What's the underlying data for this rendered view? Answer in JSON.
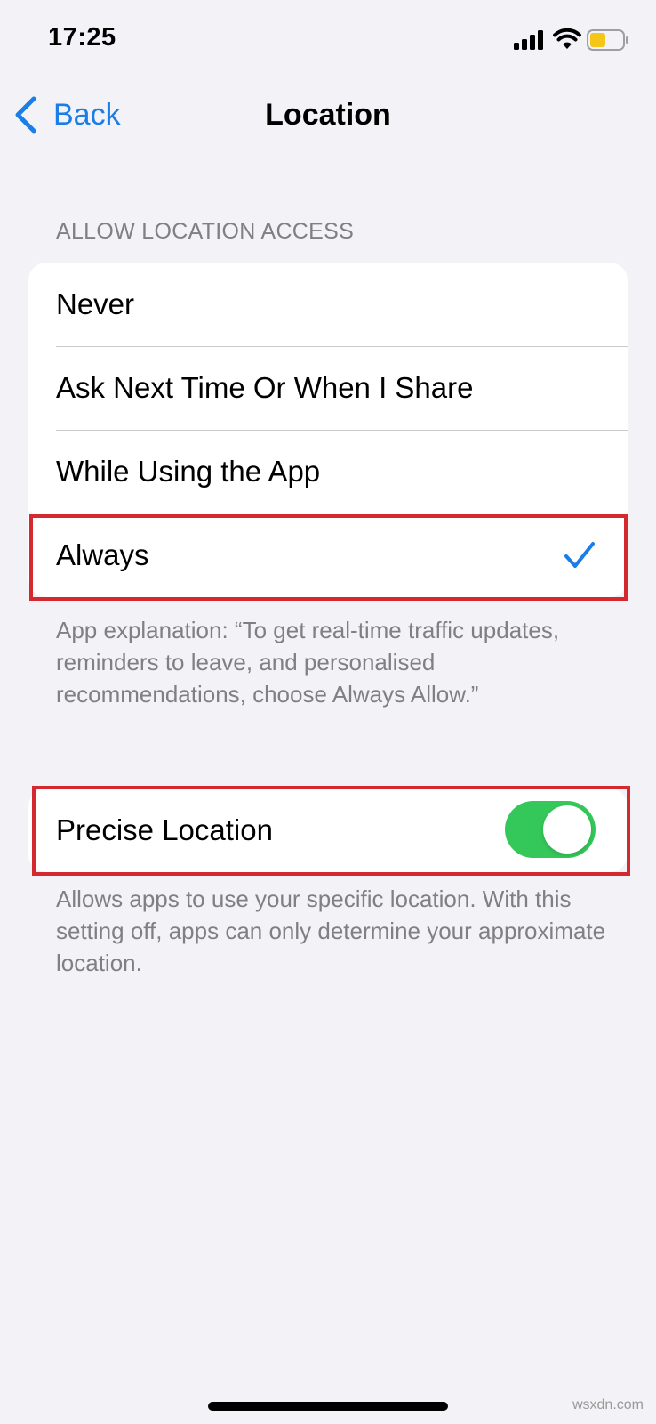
{
  "status_bar": {
    "time": "17:25",
    "signal_icon": "cellular-signal-icon",
    "wifi_icon": "wifi-icon",
    "battery_icon": "battery-icon",
    "battery_color": "#f5c518"
  },
  "nav": {
    "back_label": "Back",
    "title": "Location"
  },
  "access_section": {
    "header": "ALLOW LOCATION ACCESS",
    "options": [
      {
        "label": "Never",
        "selected": false
      },
      {
        "label": "Ask Next Time Or When I Share",
        "selected": false
      },
      {
        "label": "While Using the App",
        "selected": false
      },
      {
        "label": "Always",
        "selected": true
      }
    ],
    "explanation": "App explanation: “To get real-time traffic updates, reminders to leave, and personalised recommendations, choose Always Allow.”"
  },
  "precise_section": {
    "label": "Precise Location",
    "toggle_on": true,
    "footer": "Allows apps to use your specific location. With this setting off, apps can only determine your approximate location."
  },
  "colors": {
    "accent": "#1a7ee6",
    "toggle_on": "#34c759",
    "highlight": "#d42a2f",
    "background": "#f2f2f7"
  },
  "watermark": "wsxdn.com"
}
